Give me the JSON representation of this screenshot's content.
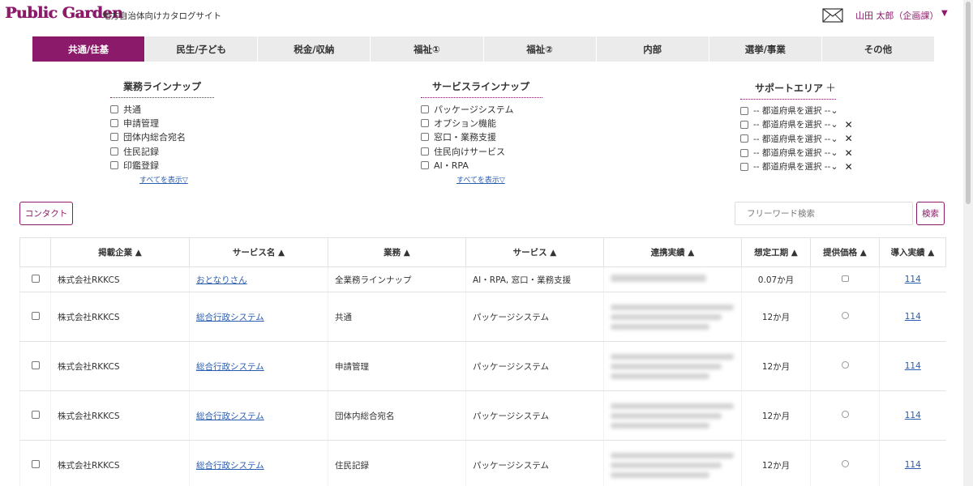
{
  "header": {
    "logo": "Public Garden",
    "tagline": "地方自治体向けカタログサイト",
    "user": "山田 太郎（企画課）",
    "user_caret": "▼"
  },
  "tabs": [
    {
      "label": "共通/住基",
      "active": true
    },
    {
      "label": "民生/子ども"
    },
    {
      "label": "税金/収納"
    },
    {
      "label": "福祉①"
    },
    {
      "label": "福祉②"
    },
    {
      "label": "内部"
    },
    {
      "label": "選挙/事業"
    },
    {
      "label": "その他"
    }
  ],
  "filters": {
    "business": {
      "title": "業務ラインナップ",
      "items": [
        "共通",
        "申請管理",
        "団体内総合宛名",
        "住民記録",
        "印鑑登録"
      ],
      "show_all": "すべてを表示▽"
    },
    "service": {
      "title": "サービスラインナップ",
      "items": [
        "パッケージシステム",
        "オプション機能",
        "窓口・業務支援",
        "住民向けサービス",
        "AI・RPA"
      ],
      "show_all": "すべてを表示▽"
    },
    "support": {
      "title": "サポートエリア",
      "plus": "＋",
      "select_label": "-- 都道府県を選択 --",
      "select_caret": "⌄",
      "remove": "✕",
      "count": 5
    }
  },
  "actions": {
    "contact": "コンタクト",
    "search_placeholder": "フリーワード検索",
    "search_button": "検索"
  },
  "table": {
    "headers": [
      "掲載企業 ▲",
      "サービス名 ▲",
      "業務 ▲",
      "サービス ▲",
      "連携実績 ▲",
      "想定工期 ▲",
      "提供価格 ▲",
      "導入実績 ▲"
    ],
    "rows": [
      {
        "company": "株式会社RKKCS",
        "service_name": "おとなりさん",
        "business": "全業務ラインナップ",
        "service": "AI・RPA, 窓口・業務支援",
        "period": "0.07か月",
        "record": "114"
      },
      {
        "company": "株式会社RKKCS",
        "service_name": "総合行政システム",
        "business": "共通",
        "service": "パッケージシステム",
        "period": "12か月",
        "record": "114"
      },
      {
        "company": "株式会社RKKCS",
        "service_name": "総合行政システム",
        "business": "申請管理",
        "service": "パッケージシステム",
        "period": "12か月",
        "record": "114"
      },
      {
        "company": "株式会社RKKCS",
        "service_name": "総合行政システム",
        "business": "団体内総合宛名",
        "service": "パッケージシステム",
        "period": "12か月",
        "record": "114"
      },
      {
        "company": "株式会社RKKCS",
        "service_name": "総合行政システム",
        "business": "住民記録",
        "service": "パッケージシステム",
        "period": "12か月",
        "record": "114"
      }
    ]
  },
  "colors": {
    "accent": "#8c1a6a",
    "tab_bg": "#ebebeb",
    "link": "#2a5db0"
  }
}
